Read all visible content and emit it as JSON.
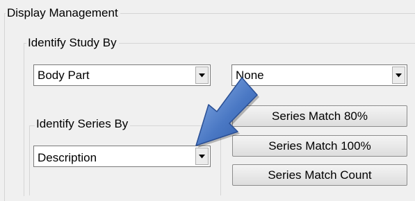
{
  "display_management": {
    "title": "Display Management",
    "identify_study": {
      "label": "Identify Study By",
      "primary_value": "Body Part",
      "secondary_value": "None"
    },
    "identify_series": {
      "label": "Identify Series By",
      "value": "Description"
    },
    "buttons": {
      "match_80": "Series Match 80%",
      "match_100": "Series Match 100%",
      "match_count": "Series Match Count"
    }
  },
  "annotation": {
    "arrow_icon": "pointer-arrow-icon",
    "arrow_color": "#4a78c4"
  }
}
